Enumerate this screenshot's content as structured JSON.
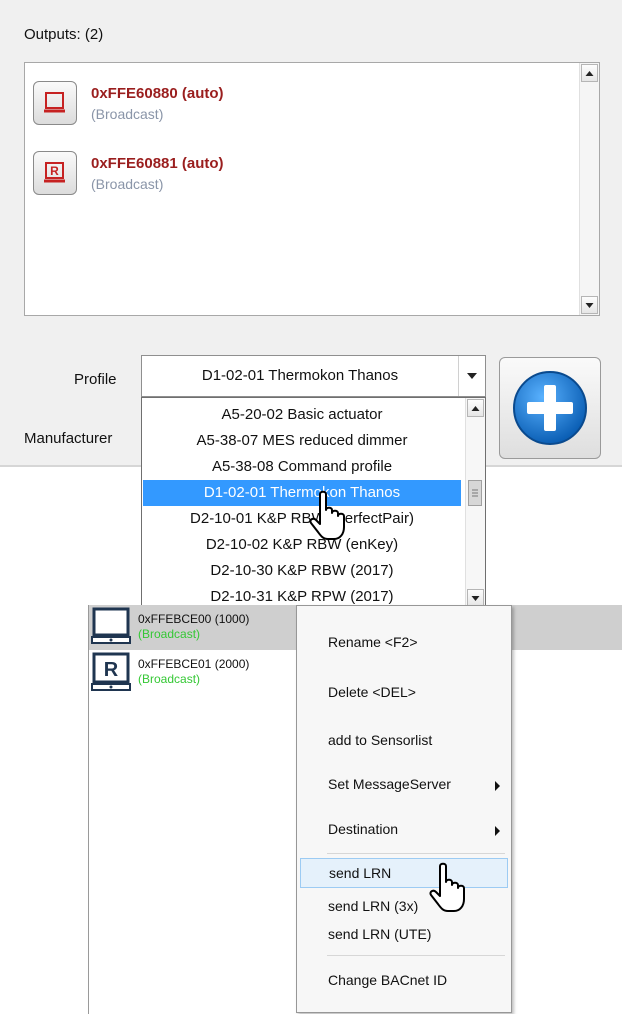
{
  "outputs": {
    "label": "Outputs: (2)",
    "items": [
      {
        "address": "0xFFE60880 (auto)",
        "sub": "(Broadcast)",
        "icon": "monitor-output-icon"
      },
      {
        "address": "0xFFE60881 (auto)",
        "sub": "(Broadcast)",
        "icon": "relay-output-icon",
        "glyph": "R"
      }
    ]
  },
  "form": {
    "profile_label": "Profile",
    "manufacturer_label": "Manufacturer",
    "profile_value": "D1-02-01 Thermokon Thanos",
    "add_button_icon": "plus-circle-icon"
  },
  "profile_dropdown": {
    "options": [
      "A5-20-02 Basic actuator",
      "A5-38-07 MES reduced dimmer",
      "A5-38-08 Command profile",
      "D1-02-01 Thermokon Thanos",
      "D2-10-01 K&P RBW (PerfectPair)",
      "D2-10-02 K&P RBW (enKey)",
      "D2-10-30 K&P RBW (2017)",
      "D2-10-31 K&P RPW (2017)"
    ],
    "selected": "D1-02-01 Thermokon Thanos"
  },
  "devices": [
    {
      "address": "0xFFEBCE00 (1000)",
      "sub": "(Broadcast)",
      "icon": "monitor-device-icon"
    },
    {
      "address": "0xFFEBCE01 (2000)",
      "sub": "(Broadcast)",
      "icon": "relay-device-icon",
      "glyph": "R"
    }
  ],
  "context_menu": {
    "items": [
      {
        "label": "Rename <F2>"
      },
      {
        "label": "Delete <DEL>"
      },
      {
        "label": "add to Sensorlist"
      },
      {
        "label": "Set MessageServer",
        "submenu": true
      },
      {
        "label": "Destination",
        "submenu": true
      },
      {
        "label": "send LRN",
        "highlighted": true
      },
      {
        "label": "send LRN (3x)"
      },
      {
        "label": "send LRN (UTE)"
      },
      {
        "label": "Change BACnet ID"
      }
    ]
  },
  "colors": {
    "address_red": "#9a1e1e",
    "broadcast_gray": "#8a95a8",
    "broadcast_green": "#35c835",
    "selection_blue": "#3399ff",
    "add_button_blue": "#1b7fd6"
  }
}
